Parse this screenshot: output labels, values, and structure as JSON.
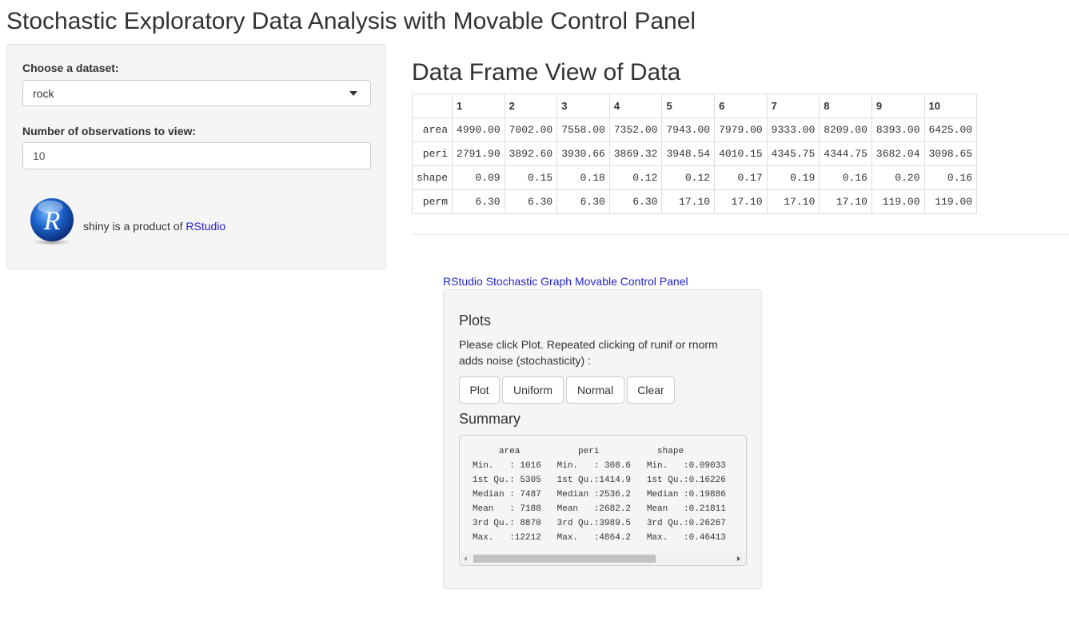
{
  "page": {
    "title": "Stochastic Exploratory Data Analysis with Movable Control Panel"
  },
  "sidebar": {
    "dataset_label": "Choose a dataset:",
    "dataset_value": "rock",
    "obs_label": "Number of observations to view:",
    "obs_value": "10",
    "logo_letter": "R",
    "credit_text": "shiny is a product of ",
    "credit_link": "RStudio"
  },
  "main": {
    "heading": "Data Frame View of Data",
    "table": {
      "columns": [
        "",
        "1",
        "2",
        "3",
        "4",
        "5",
        "6",
        "7",
        "8",
        "9",
        "10"
      ],
      "rows": [
        [
          "area",
          "4990.00",
          "7002.00",
          "7558.00",
          "7352.00",
          "7943.00",
          "7979.00",
          "9333.00",
          "8209.00",
          "8393.00",
          "6425.00"
        ],
        [
          "peri",
          "2791.90",
          "3892.60",
          "3930.66",
          "3869.32",
          "3948.54",
          "4010.15",
          "4345.75",
          "4344.75",
          "3682.04",
          "3098.65"
        ],
        [
          "shape",
          "0.09",
          "0.15",
          "0.18",
          "0.12",
          "0.12",
          "0.17",
          "0.19",
          "0.16",
          "0.20",
          "0.16"
        ],
        [
          "perm",
          "6.30",
          "6.30",
          "6.30",
          "6.30",
          "17.10",
          "17.10",
          "17.10",
          "17.10",
          "119.00",
          "119.00"
        ]
      ]
    }
  },
  "panel": {
    "link_text": "RStudio Stochastic Graph Movable Control Panel",
    "plots_heading": "Plots",
    "instructions": "Please click Plot. Repeated clicking of runif or rnorm adds noise (stochasticity) :",
    "buttons": {
      "plot": "Plot",
      "uniform": "Uniform",
      "normal": "Normal",
      "clear": "Clear"
    },
    "summary_heading": "Summary",
    "summary_text": "     area           peri           shape    \nMin.   : 1016   Min.   : 308.6   Min.   :0.09033\n1st Qu.: 5305   1st Qu.:1414.9   1st Qu.:0.16226\nMedian : 7487   Median :2536.2   Median :0.19886\nMean   : 7188   Mean   :2682.2   Mean   :0.21811\n3rd Qu.: 8870   3rd Qu.:3989.5   3rd Qu.:0.26267\nMax.   :12212   Max.   :4864.2   Max.   :0.46413"
  },
  "colors": {
    "link": "#2222cc",
    "well_bg": "#f5f5f5",
    "border": "#cccccc",
    "logo_blue": "#1a5fc8"
  },
  "icons": {
    "select_caret": "caret-down-icon",
    "logo": "r-logo-icon"
  }
}
